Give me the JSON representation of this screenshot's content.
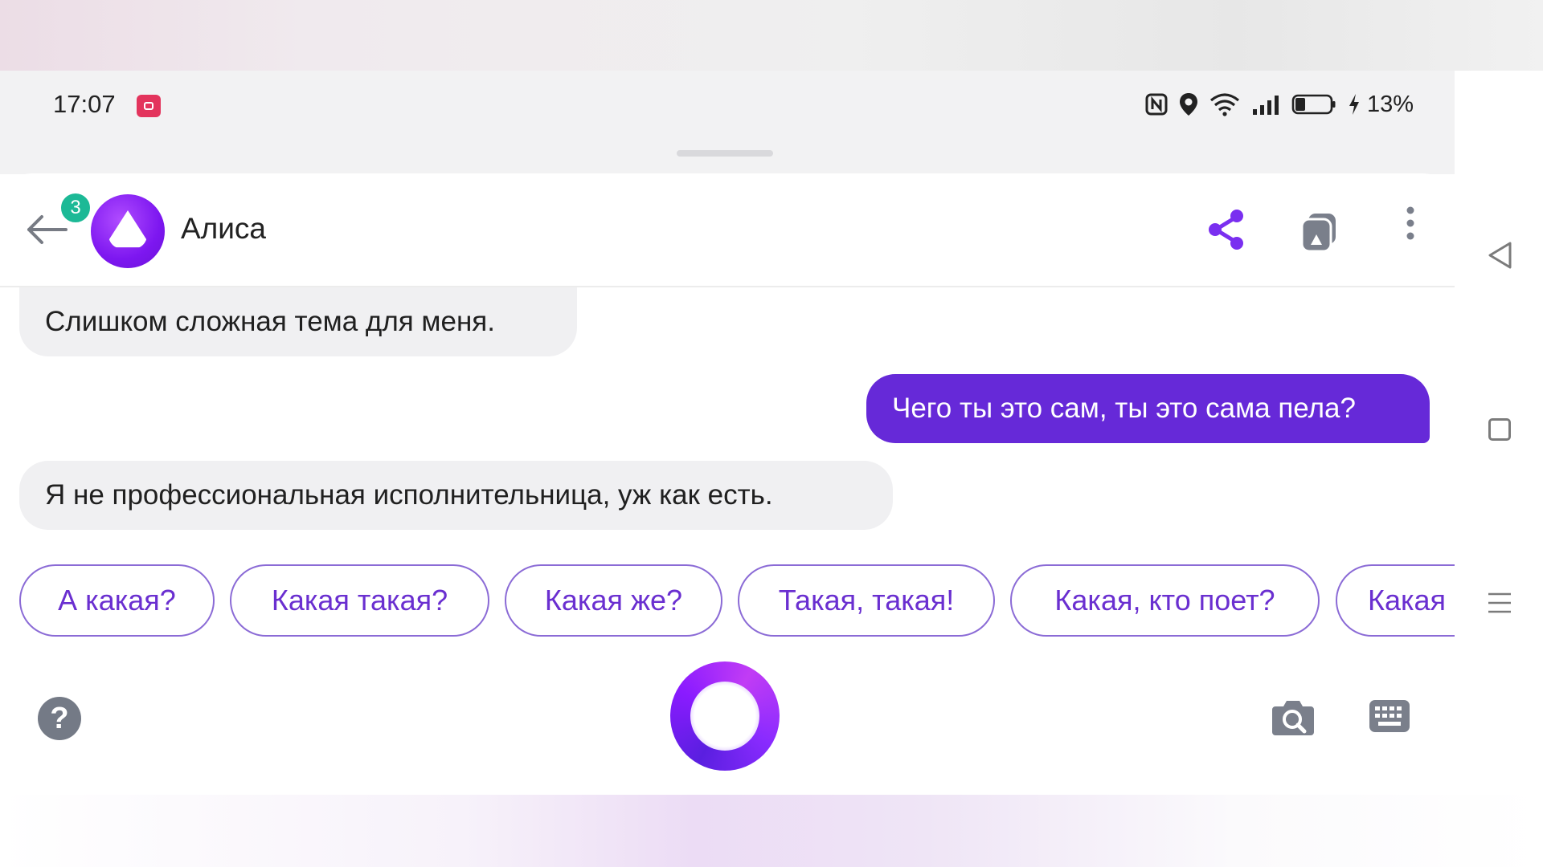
{
  "status_bar": {
    "time": "17:07",
    "icons": [
      "recording-icon",
      "nfc-icon",
      "location-icon",
      "wifi-icon",
      "signal-icon",
      "battery-icon",
      "charging-icon"
    ],
    "battery": "13%",
    "battery_level": 0.13
  },
  "header": {
    "back_icon": "arrow-left-icon",
    "badge_count": "3",
    "title": "Алиса",
    "actions": [
      "share-icon",
      "copy-icon",
      "more-vertical-icon"
    ]
  },
  "messages": [
    {
      "from": "assistant",
      "text": "Слишком сложная тема для меня."
    },
    {
      "from": "user",
      "text": "Чего ты это сам, ты это сама пела?"
    },
    {
      "from": "assistant",
      "text": "Я не профессиональная исполнительница, уж как есть."
    }
  ],
  "suggestions": [
    "А какая?",
    "Какая такая?",
    "Какая же?",
    "Такая, такая!",
    "Какая, кто поет?",
    "Какая"
  ],
  "bottom_bar": {
    "help_label": "?",
    "icons": [
      "help-icon",
      "voice-assistant-icon",
      "camera-search-icon",
      "keyboard-icon"
    ]
  },
  "colors": {
    "accent": "#6629d8",
    "chip_text": "#6a2fd0",
    "badge": "#1cb996",
    "assistant_bubble": "#f0f0f2"
  }
}
